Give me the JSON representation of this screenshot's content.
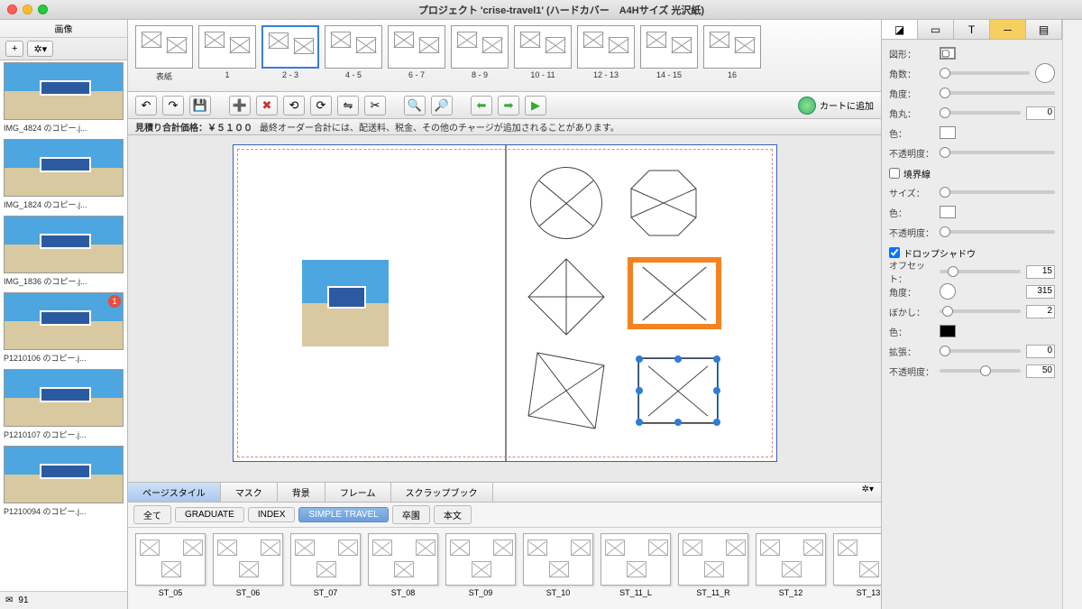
{
  "window": {
    "title": "プロジェクト 'crise-travel1' (ハードカバー　A4Hサイズ 光沢紙)"
  },
  "left": {
    "title": "画像",
    "add": "+",
    "gear": "✲▾",
    "thumbs": [
      {
        "label": "IMG_4824 のコピー.j..."
      },
      {
        "label": "IMG_1824 のコピー.j..."
      },
      {
        "label": "IMG_1836 のコピー.j..."
      },
      {
        "label": "P1210106 のコピー.j...",
        "badge": "1"
      },
      {
        "label": "P1210107 のコピー.j..."
      },
      {
        "label": "P1210094 のコピー.j..."
      }
    ],
    "count": "91"
  },
  "pages": [
    {
      "label": "表紙"
    },
    {
      "label": "1"
    },
    {
      "label": "2 - 3",
      "selected": true
    },
    {
      "label": "4 - 5"
    },
    {
      "label": "6 - 7"
    },
    {
      "label": "8 - 9"
    },
    {
      "label": "10 - 11"
    },
    {
      "label": "12 - 13"
    },
    {
      "label": "14 - 15"
    },
    {
      "label": "16"
    }
  ],
  "toolbar": {
    "cart": "カートに追加"
  },
  "price": {
    "label": "見積り合計価格：",
    "value": "￥５１００",
    "note": "最終オーダー合計には、配送料、税金、その他のチャージが追加されることがあります。"
  },
  "tabs": {
    "items": [
      "ページスタイル",
      "マスク",
      "背景",
      "フレーム",
      "スクラップブック"
    ],
    "active": 0
  },
  "filters": {
    "items": [
      "全て",
      "GRADUATE",
      "INDEX",
      "SIMPLE TRAVEL",
      "卒園",
      "本文"
    ],
    "active": 3
  },
  "templates": [
    "ST_05",
    "ST_06",
    "ST_07",
    "ST_08",
    "ST_09",
    "ST_10",
    "ST_11_L",
    "ST_11_R",
    "ST_12",
    "ST_13"
  ],
  "inspector": {
    "shape_label": "図形：",
    "corner_count": "角数：",
    "angle": "角度：",
    "corner_radius": "角丸：",
    "corner_radius_val": "0",
    "color": "色：",
    "opacity": "不透明度：",
    "border_chk": "境界線",
    "size": "サイズ：",
    "shadow_chk": "ドロップシャドウ",
    "offset": "オフセット：",
    "offset_val": "15",
    "s_angle": "角度：",
    "s_angle_val": "315",
    "blur": "ぼかし：",
    "blur_val": "2",
    "s_color": "色：",
    "spread": "拡張：",
    "spread_val": "0",
    "s_opacity": "不透明度：",
    "s_opacity_val": "50"
  }
}
